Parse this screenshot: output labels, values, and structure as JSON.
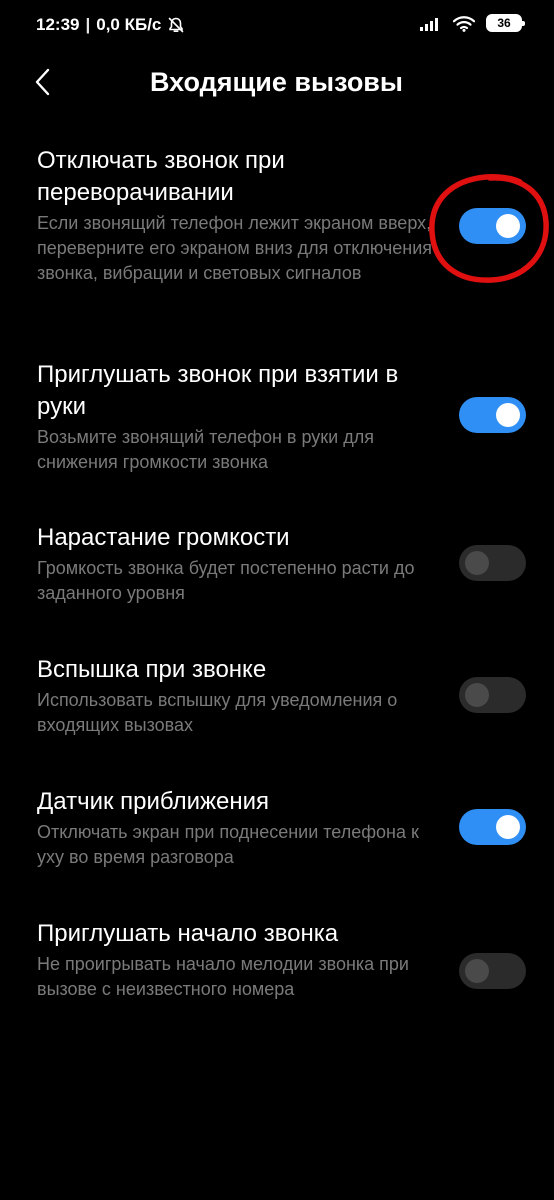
{
  "status_bar": {
    "time": "12:39",
    "separator": "|",
    "network_speed": "0,0 КБ/с",
    "battery": "36",
    "icons": [
      "mute-bell-icon",
      "signal-icon",
      "wifi-icon",
      "battery-icon"
    ]
  },
  "header": {
    "title": "Входящие вызовы",
    "back_icon": "chevron-left-icon"
  },
  "colors": {
    "background": "#000000",
    "accent": "#2f8ff5",
    "description": "#7a7a7a",
    "toggle_off": "#2b2b2b",
    "annotation": "#e01010"
  },
  "settings": [
    {
      "title": "Отключать звонок при переворачивании",
      "description": "Если звонящий телефон лежит экраном вверх, переверните его экраном вниз для отключения звонка, вибрации и световых сигналов",
      "enabled": true
    },
    {
      "title": "Приглушать звонок при взятии в руки",
      "description": "Возьмите звонящий телефон в руки для снижения громкости звонка",
      "enabled": true
    },
    {
      "title": "Нарастание громкости",
      "description": "Громкость звонка будет постепенно расти до заданного уровня",
      "enabled": false
    },
    {
      "title": "Вспышка при звонке",
      "description": "Использовать вспышку для уведомления о входящих вызовах",
      "enabled": false
    },
    {
      "title": "Датчик приближения",
      "description": "Отключать экран при поднесении телефона к уху во время разговора",
      "enabled": true
    },
    {
      "title": "Приглушать начало звонка",
      "description": "Не проигрывать начало мелодии звонка при вызове с неизвестного номера",
      "enabled": false
    }
  ]
}
